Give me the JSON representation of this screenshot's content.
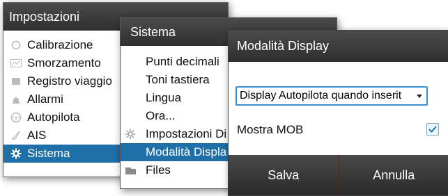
{
  "panel1": {
    "title": "Impostazioni",
    "items": [
      {
        "label": "Calibrazione",
        "icon": "calibration-icon"
      },
      {
        "label": "Smorzamento",
        "icon": "damping-icon"
      },
      {
        "label": "Registro viaggio",
        "icon": "log-icon"
      },
      {
        "label": "Allarmi",
        "icon": "alarm-icon"
      },
      {
        "label": "Autopilota",
        "icon": "autopilot-icon"
      },
      {
        "label": "AIS",
        "icon": "ais-icon"
      },
      {
        "label": "Sistema",
        "icon": "gear-icon",
        "selected": true
      }
    ]
  },
  "panel2": {
    "title": "Sistema",
    "items": [
      {
        "label": "Punti decimali"
      },
      {
        "label": "Toni tastiera"
      },
      {
        "label": "Lingua"
      },
      {
        "label": "Ora..."
      },
      {
        "label": "Impostazioni Di",
        "icon": "settings-gear-icon"
      },
      {
        "label": "Modalità Displa",
        "selected": true
      },
      {
        "label": "Files",
        "icon": "folder-icon"
      }
    ]
  },
  "dialog": {
    "title": "Modalità Display",
    "dropdown_value": "Display Autopilota quando inserit",
    "mob_label": "Mostra MOB",
    "mob_checked": true,
    "save_label": "Salva",
    "cancel_label": "Annulla"
  },
  "colors": {
    "selection": "#1f6fa8",
    "titlebar": "#3a3a3a",
    "accent": "#3a8fd0"
  }
}
